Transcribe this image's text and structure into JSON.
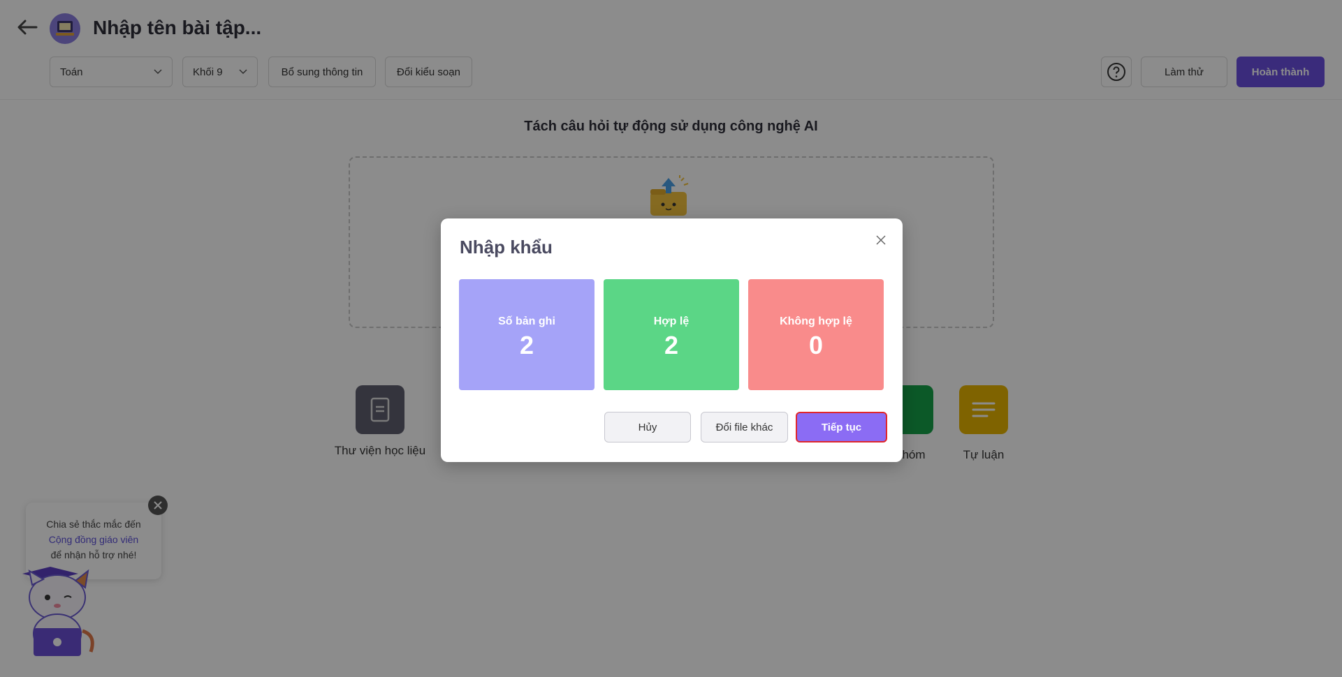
{
  "header": {
    "title": "Nhập tên bài tập...",
    "subject_select": "Toán",
    "grade_select": "Khối 9",
    "extra_info_label": "Bổ sung thông tin",
    "change_type_label": "Đổi kiểu soạn",
    "try_label": "Làm thử",
    "finish_label": "Hoàn thành",
    "help_icon": "question-circle-icon"
  },
  "main": {
    "ai_heading": "Tách câu hỏi tự động sử dụng công nghệ AI",
    "tools": [
      {
        "label": "Thư viện học liệu",
        "icon": "book-icon"
      },
      {
        "label": "nhóm",
        "icon": "group-icon"
      },
      {
        "label": "Tự luận",
        "icon": "lines-icon"
      }
    ]
  },
  "help_bubble": {
    "line1": "Chia sẻ thắc mắc đến",
    "link": "Cộng đồng giáo viên",
    "line3": "để nhận hỗ trợ nhé!"
  },
  "modal": {
    "title": "Nhập khẩu",
    "stats": [
      {
        "label": "Số bản ghi",
        "value": "2"
      },
      {
        "label": "Hợp lệ",
        "value": "2"
      },
      {
        "label": "Không hợp lệ",
        "value": "0"
      }
    ],
    "cancel_label": "Hủy",
    "change_file_label": "Đổi file khác",
    "continue_label": "Tiếp tục"
  },
  "colors": {
    "primary": "#6a4fe0",
    "stat_total": "#a5a3f8",
    "stat_valid": "#5bd686",
    "stat_invalid": "#f98b8b",
    "focus_outline": "#e0262b"
  }
}
